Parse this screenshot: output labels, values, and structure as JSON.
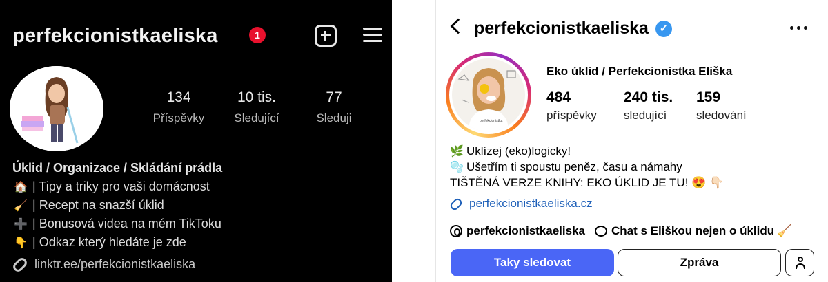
{
  "left_profile": {
    "username": "perfekcionistkaeliska",
    "notification_count": "1",
    "stats": [
      {
        "value": "134",
        "label": "Příspěvky"
      },
      {
        "value": "10 tis.",
        "label": "Sledující"
      },
      {
        "value": "77",
        "label": "Sleduji"
      }
    ],
    "bio_headline": "Úklid / Organizace / Skládání prádla",
    "bio_lines": [
      {
        "emoji": "🏠",
        "text": "| Tipy a triky pro vaši domácnost"
      },
      {
        "emoji": "🧹",
        "text": "| Recept na snazší úklid"
      },
      {
        "emoji": "➕",
        "text": "| Bonusová videa na mém TikToku"
      },
      {
        "emoji": "👇",
        "text": "| Odkaz který hledáte je zde"
      }
    ],
    "link": "linktr.ee/perfekcionistkaeliska",
    "icons": {
      "add": "plus-square-icon",
      "menu": "hamburger-menu-icon",
      "link": "link-icon"
    }
  },
  "right_profile": {
    "username": "perfekcionistkaeliska",
    "verified_mark": "✓",
    "full_name": "Eko úklid / Perfekcionistka Eliška",
    "stats": [
      {
        "value": "484",
        "label": "příspěvky"
      },
      {
        "value": "240 tis.",
        "label": "sledující"
      },
      {
        "value": "159",
        "label": "sledování"
      }
    ],
    "bio_lines": [
      {
        "emoji": "🌿",
        "text": "Uklízej (eko)logicky!"
      },
      {
        "emoji": "🫧",
        "text": "Ušetřím ti spoustu peněz, času a námahy"
      },
      {
        "emoji": "",
        "text": "TIŠTĚNÁ VERZE KNIHY: EKO ÚKLID JE TU! 😍 👇🏻"
      }
    ],
    "link": "perfekcionistkaeliska.cz",
    "chips": [
      {
        "label": "perfekcionistkaeliska",
        "icon": "threads-icon"
      },
      {
        "label": "Chat s Eliškou nejen o úklidu 🧹",
        "icon": "chat-icon"
      }
    ],
    "buttons": {
      "follow": "Taky sledovat",
      "message": "Zpráva"
    },
    "colors": {
      "follow_button": "#4a66f6",
      "link": "#1d5fb8",
      "verified": "#3897f0"
    }
  }
}
